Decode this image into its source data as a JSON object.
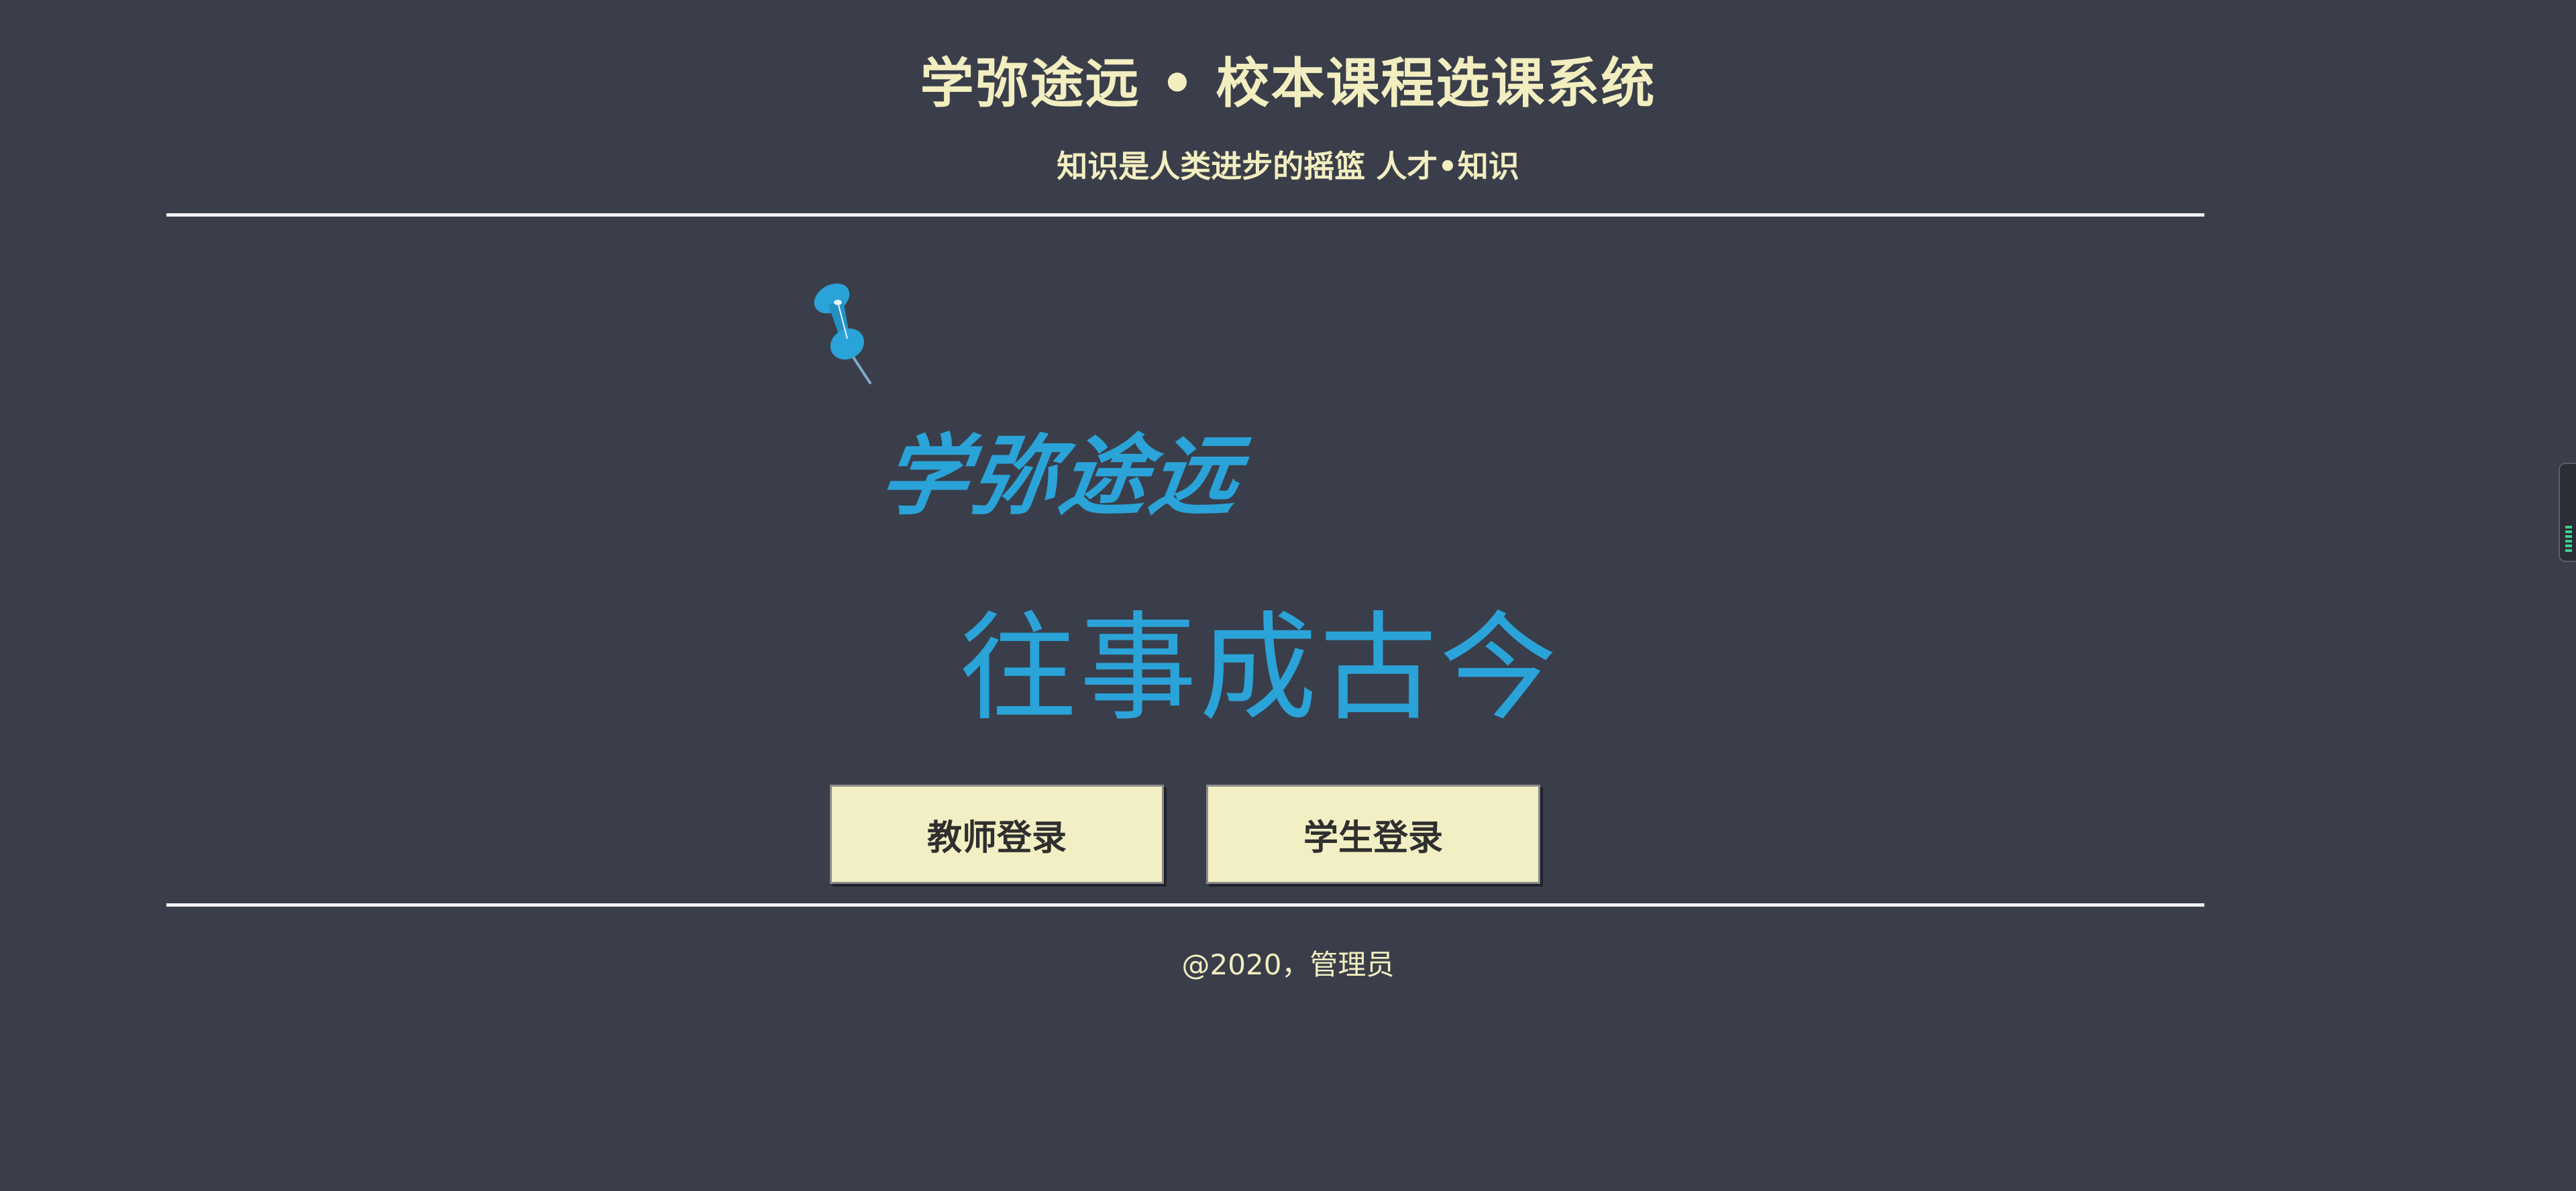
{
  "header": {
    "title": "学弥途远 • 校本课程选课系统",
    "subtitle": "知识是人类进步的摇篮 人才•知识"
  },
  "main": {
    "logo_text": "学弥途远",
    "slogan": "往事成古今",
    "teacher_login_label": "教师登录",
    "student_login_label": "学生登录"
  },
  "footer": {
    "text": "@2020，管理员"
  },
  "icons": {
    "pushpin": "pushpin-icon",
    "side_panel": "side-panel-handle-icon"
  },
  "colors": {
    "background": "#3a3e4a",
    "title_text": "#f2eec0",
    "accent_blue": "#2aa3d8",
    "button_bg": "#f3efc4"
  }
}
